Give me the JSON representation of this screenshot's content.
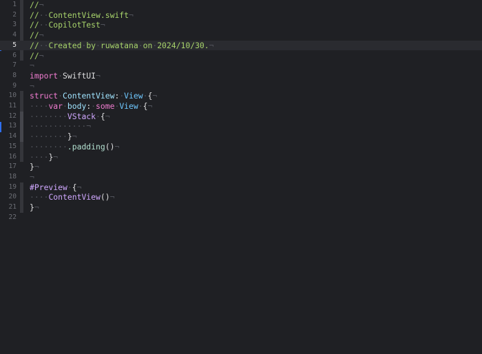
{
  "editor": {
    "lines": [
      {
        "n": "1",
        "tokens": [
          {
            "t": "//",
            "c": "comment"
          },
          {
            "t": "¬",
            "c": "inv"
          }
        ]
      },
      {
        "n": "2",
        "tokens": [
          {
            "t": "//",
            "c": "comment"
          },
          {
            "t": "··",
            "c": "inv"
          },
          {
            "t": "ContentView.swift",
            "c": "comment"
          },
          {
            "t": "¬",
            "c": "inv"
          }
        ]
      },
      {
        "n": "3",
        "tokens": [
          {
            "t": "//",
            "c": "comment"
          },
          {
            "t": "··",
            "c": "inv"
          },
          {
            "t": "CopilotTest",
            "c": "comment"
          },
          {
            "t": "¬",
            "c": "inv"
          }
        ]
      },
      {
        "n": "4",
        "tokens": [
          {
            "t": "//",
            "c": "comment"
          },
          {
            "t": "¬",
            "c": "inv"
          }
        ]
      },
      {
        "n": "5",
        "current": true,
        "tokens": [
          {
            "t": "//",
            "c": "comment"
          },
          {
            "t": "··",
            "c": "inv"
          },
          {
            "t": "Created",
            "c": "comment"
          },
          {
            "t": "·",
            "c": "inv"
          },
          {
            "t": "by",
            "c": "comment"
          },
          {
            "t": "·",
            "c": "inv"
          },
          {
            "t": "ruwatana",
            "c": "comment"
          },
          {
            "t": "·",
            "c": "inv"
          },
          {
            "t": "on",
            "c": "comment"
          },
          {
            "t": "·",
            "c": "inv"
          },
          {
            "t": "2024/10/30.",
            "c": "comment"
          },
          {
            "t": "¬",
            "c": "inv"
          }
        ]
      },
      {
        "n": "6",
        "tokens": [
          {
            "t": "//",
            "c": "comment"
          },
          {
            "t": "¬",
            "c": "inv"
          }
        ]
      },
      {
        "n": "7",
        "tokens": [
          {
            "t": "¬",
            "c": "inv"
          }
        ]
      },
      {
        "n": "8",
        "tokens": [
          {
            "t": "import",
            "c": "kw"
          },
          {
            "t": "·",
            "c": "inv"
          },
          {
            "t": "SwiftUI",
            "c": "plain"
          },
          {
            "t": "¬",
            "c": "inv"
          }
        ]
      },
      {
        "n": "9",
        "tokens": [
          {
            "t": "¬",
            "c": "inv"
          }
        ]
      },
      {
        "n": "10",
        "tokens": [
          {
            "t": "struct",
            "c": "kw"
          },
          {
            "t": "·",
            "c": "inv"
          },
          {
            "t": "ContentView",
            "c": "decl"
          },
          {
            "t": ":",
            "c": "plain"
          },
          {
            "t": "·",
            "c": "inv"
          },
          {
            "t": "View",
            "c": "cls"
          },
          {
            "t": "·",
            "c": "inv"
          },
          {
            "t": "{",
            "c": "plain"
          },
          {
            "t": "¬",
            "c": "inv"
          }
        ]
      },
      {
        "n": "11",
        "tokens": [
          {
            "t": "····",
            "c": "inv"
          },
          {
            "t": "var",
            "c": "kw"
          },
          {
            "t": "·",
            "c": "inv"
          },
          {
            "t": "body",
            "c": "decl"
          },
          {
            "t": ":",
            "c": "plain"
          },
          {
            "t": "·",
            "c": "inv"
          },
          {
            "t": "some",
            "c": "kw"
          },
          {
            "t": "·",
            "c": "inv"
          },
          {
            "t": "View",
            "c": "cls"
          },
          {
            "t": "·",
            "c": "inv"
          },
          {
            "t": "{",
            "c": "plain"
          },
          {
            "t": "¬",
            "c": "inv"
          }
        ]
      },
      {
        "n": "12",
        "tokens": [
          {
            "t": "········",
            "c": "inv"
          },
          {
            "t": "VStack",
            "c": "type"
          },
          {
            "t": "·",
            "c": "inv"
          },
          {
            "t": "{",
            "c": "plain"
          },
          {
            "t": "¬",
            "c": "inv"
          }
        ]
      },
      {
        "n": "13",
        "tokens": [
          {
            "t": "············¬",
            "c": "inv"
          }
        ]
      },
      {
        "n": "14",
        "tokens": [
          {
            "t": "········",
            "c": "inv"
          },
          {
            "t": "}",
            "c": "plain"
          },
          {
            "t": "¬",
            "c": "inv"
          }
        ]
      },
      {
        "n": "15",
        "tokens": [
          {
            "t": "········",
            "c": "inv"
          },
          {
            "t": ".padding",
            "c": "fn"
          },
          {
            "t": "()",
            "c": "plain"
          },
          {
            "t": "¬",
            "c": "inv"
          }
        ]
      },
      {
        "n": "16",
        "tokens": [
          {
            "t": "····",
            "c": "inv"
          },
          {
            "t": "}",
            "c": "plain"
          },
          {
            "t": "¬",
            "c": "inv"
          }
        ]
      },
      {
        "n": "17",
        "tokens": [
          {
            "t": "}",
            "c": "plain"
          },
          {
            "t": "¬",
            "c": "inv"
          }
        ]
      },
      {
        "n": "18",
        "tokens": [
          {
            "t": "¬",
            "c": "inv"
          }
        ]
      },
      {
        "n": "19",
        "tokens": [
          {
            "t": "#Preview",
            "c": "type"
          },
          {
            "t": "·",
            "c": "inv"
          },
          {
            "t": "{",
            "c": "plain"
          },
          {
            "t": "¬",
            "c": "inv"
          }
        ]
      },
      {
        "n": "20",
        "tokens": [
          {
            "t": "····",
            "c": "inv"
          },
          {
            "t": "ContentView",
            "c": "type"
          },
          {
            "t": "()",
            "c": "plain"
          },
          {
            "t": "¬",
            "c": "inv"
          }
        ]
      },
      {
        "n": "21",
        "tokens": [
          {
            "t": "}",
            "c": "plain"
          },
          {
            "t": "¬",
            "c": "inv"
          }
        ]
      },
      {
        "n": "22",
        "tokens": []
      }
    ]
  }
}
